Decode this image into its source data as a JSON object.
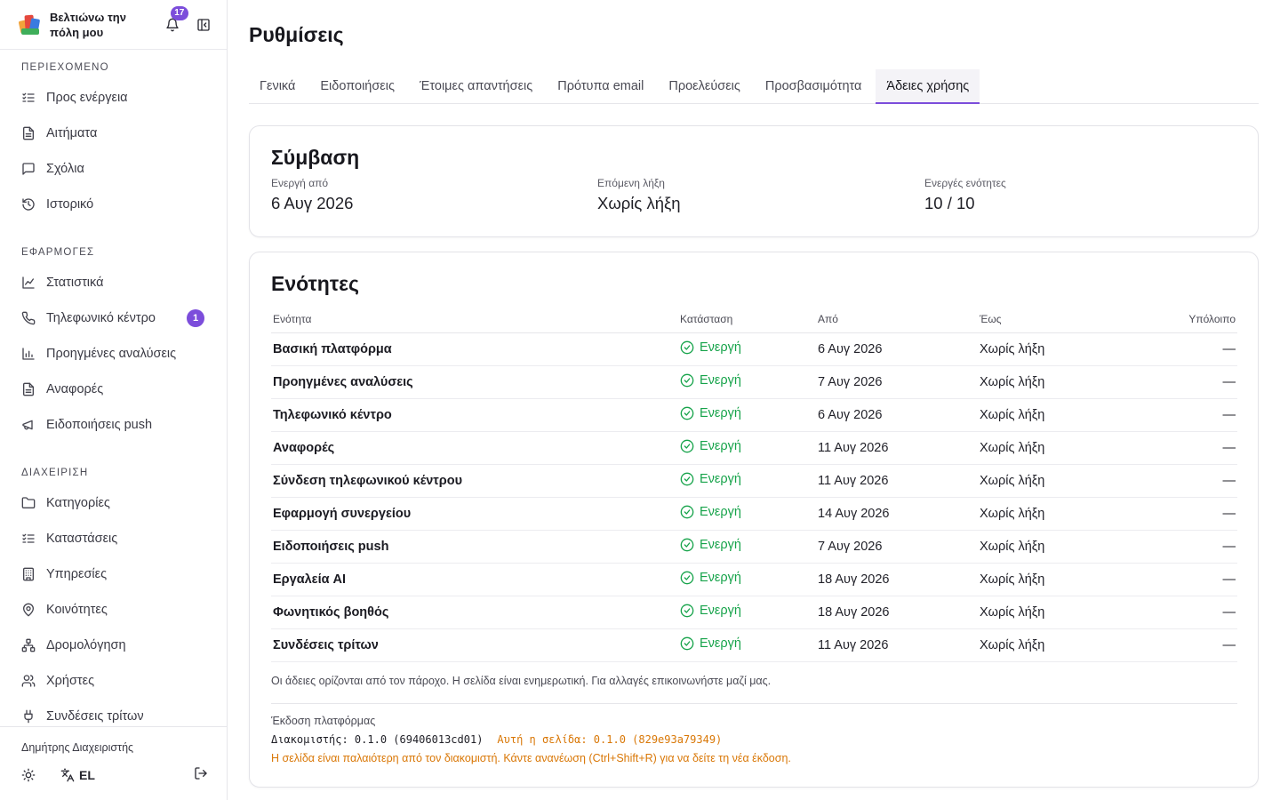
{
  "app": {
    "name": "Βελτιώνω την πόλη μου",
    "notifications_count": "17"
  },
  "sidebar": {
    "sections": [
      {
        "title": "ΠΕΡΙΕΧΟΜΕΝΟ",
        "items": [
          {
            "label": "Προς ενέργεια",
            "icon": "list-check-icon"
          },
          {
            "label": "Αιτήματα",
            "icon": "document-icon"
          },
          {
            "label": "Σχόλια",
            "icon": "comment-icon"
          },
          {
            "label": "Ιστορικό",
            "icon": "history-icon"
          }
        ]
      },
      {
        "title": "ΕΦΑΡΜΟΓΕΣ",
        "items": [
          {
            "label": "Στατιστικά",
            "icon": "line-chart-icon"
          },
          {
            "label": "Τηλεφωνικό κέντρο",
            "icon": "phone-icon",
            "badge": "1"
          },
          {
            "label": "Προηγμένες αναλύσεις",
            "icon": "bar-chart-icon"
          },
          {
            "label": "Αναφορές",
            "icon": "document-icon"
          },
          {
            "label": "Ειδοποιήσεις push",
            "icon": "megaphone-icon"
          }
        ]
      },
      {
        "title": "ΔΙΑΧΕΙΡΙΣΗ",
        "items": [
          {
            "label": "Κατηγορίες",
            "icon": "folder-icon"
          },
          {
            "label": "Καταστάσεις",
            "icon": "list-check-icon"
          },
          {
            "label": "Υπηρεσίες",
            "icon": "building-icon"
          },
          {
            "label": "Κοινότητες",
            "icon": "map-pin-icon"
          },
          {
            "label": "Δρομολόγηση",
            "icon": "routing-icon"
          },
          {
            "label": "Χρήστες",
            "icon": "users-icon"
          },
          {
            "label": "Συνδέσεις τρίτων",
            "icon": "plug-icon"
          }
        ]
      }
    ],
    "footer": {
      "user": "Δημήτρης Διαχειριστής",
      "language": "EL"
    }
  },
  "page": {
    "title": "Ρυθμίσεις",
    "tabs": [
      "Γενικά",
      "Ειδοποιήσεις",
      "Έτοιμες απαντήσεις",
      "Πρότυπα email",
      "Προελεύσεις",
      "Προσβασιμότητα",
      "Άδειες χρήσης"
    ],
    "active_tab": "Άδειες χρήσης"
  },
  "contract": {
    "title": "Σύμβαση",
    "active_from_label": "Ενεργή από",
    "active_from": "6 Αυγ 2026",
    "next_expiry_label": "Επόμενη λήξη",
    "next_expiry": "Χωρίς λήξη",
    "active_modules_label": "Ενεργές ενότητες",
    "active_modules": "10 / 10"
  },
  "modules": {
    "title": "Ενότητες",
    "columns": [
      "Ενότητα",
      "Κατάσταση",
      "Από",
      "Έως",
      "Υπόλοιπο"
    ],
    "rows": [
      {
        "name": "Βασική πλατφόρμα",
        "status": "Ενεργή",
        "from": "6 Αυγ 2026",
        "to": "Χωρίς λήξη",
        "remaining": "—"
      },
      {
        "name": "Προηγμένες αναλύσεις",
        "status": "Ενεργή",
        "from": "7 Αυγ 2026",
        "to": "Χωρίς λήξη",
        "remaining": "—"
      },
      {
        "name": "Τηλεφωνικό κέντρο",
        "status": "Ενεργή",
        "from": "6 Αυγ 2026",
        "to": "Χωρίς λήξη",
        "remaining": "—"
      },
      {
        "name": "Αναφορές",
        "status": "Ενεργή",
        "from": "11 Αυγ 2026",
        "to": "Χωρίς λήξη",
        "remaining": "—"
      },
      {
        "name": "Σύνδεση τηλεφωνικού κέντρου",
        "status": "Ενεργή",
        "from": "11 Αυγ 2026",
        "to": "Χωρίς λήξη",
        "remaining": "—"
      },
      {
        "name": "Εφαρμογή συνεργείου",
        "status": "Ενεργή",
        "from": "14 Αυγ 2026",
        "to": "Χωρίς λήξη",
        "remaining": "—"
      },
      {
        "name": "Ειδοποιήσεις push",
        "status": "Ενεργή",
        "from": "7 Αυγ 2026",
        "to": "Χωρίς λήξη",
        "remaining": "—"
      },
      {
        "name": "Εργαλεία AI",
        "status": "Ενεργή",
        "from": "18 Αυγ 2026",
        "to": "Χωρίς λήξη",
        "remaining": "—"
      },
      {
        "name": "Φωνητικός βοηθός",
        "status": "Ενεργή",
        "from": "18 Αυγ 2026",
        "to": "Χωρίς λήξη",
        "remaining": "—"
      },
      {
        "name": "Συνδέσεις τρίτων",
        "status": "Ενεργή",
        "from": "11 Αυγ 2026",
        "to": "Χωρίς λήξη",
        "remaining": "—"
      }
    ],
    "note": "Οι άδειες ορίζονται από τον πάροχο. Η σελίδα είναι ενημερωτική. Για αλλαγές επικοινωνήστε μαζί μας."
  },
  "version": {
    "label": "Έκδοση πλατφόρμας",
    "server": "Διακομιστής: 0.1.0 (69406013cd01)",
    "page": "Αυτή η σελίδα: 0.1.0 (829e93a79349)",
    "warning": "Η σελίδα είναι παλαιότερη από τον διακομιστή. Κάντε ανανέωση (Ctrl+Shift+R) για να δείτε τη νέα έκδοση."
  },
  "colors": {
    "accent": "#7c4ddb",
    "success": "#16a34a",
    "warning": "#d97706"
  }
}
